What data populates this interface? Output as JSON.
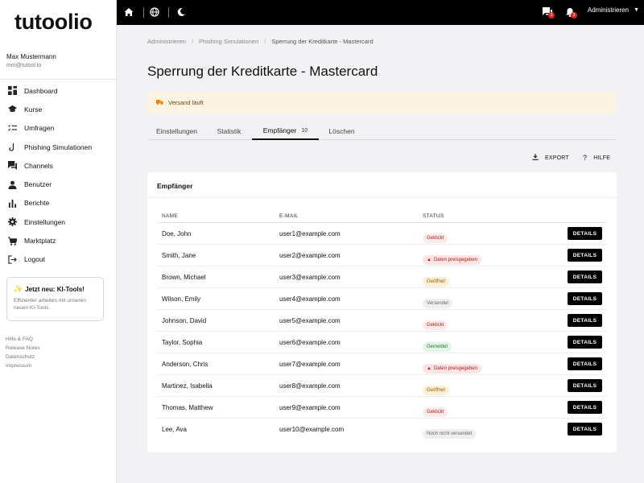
{
  "brand": {
    "logo": "tutoolio"
  },
  "user": {
    "name": "Max Mustermann",
    "email": "mm@tutool.io"
  },
  "sidebar": {
    "items": [
      {
        "label": "Dashboard",
        "icon": "dashboard-icon"
      },
      {
        "label": "Kurse",
        "icon": "graduation-cap-icon"
      },
      {
        "label": "Umfragen",
        "icon": "checklist-icon"
      },
      {
        "label": "Phishing Simulationen",
        "icon": "hook-icon"
      },
      {
        "label": "Channels",
        "icon": "chat-icon"
      },
      {
        "label": "Benutzer",
        "icon": "person-icon"
      },
      {
        "label": "Berichte",
        "icon": "bar-chart-icon"
      },
      {
        "label": "Einstellungen",
        "icon": "gear-icon"
      },
      {
        "label": "Marktplatz",
        "icon": "cart-icon"
      },
      {
        "label": "Logout",
        "icon": "logout-icon"
      }
    ],
    "promo": {
      "title": "Jetzt neu: KI-Tools!",
      "text": "Effizienter arbeiten mit unseren neuen KI-Tools."
    },
    "footer_links": [
      "Hilfe & FAQ",
      "Release Notes",
      "Datenschutz",
      "Impressum"
    ]
  },
  "topbar": {
    "notifications": {
      "chat_count": "3",
      "bell_count": "3"
    },
    "user_menu": "Administrieren"
  },
  "breadcrumb": [
    "Administrieren",
    "Phishing Simulationen",
    "Sperrung der Kreditkarte - Mastercard"
  ],
  "page": {
    "title": "Sperrung der Kreditkarte - Mastercard"
  },
  "status_banner": {
    "text": "Versand läuft"
  },
  "tabs": [
    {
      "label": "Einstellungen"
    },
    {
      "label": "Statistik"
    },
    {
      "label": "Empfänger",
      "count": "10",
      "active": true
    },
    {
      "label": "Löschen"
    }
  ],
  "actions": {
    "export": "EXPORT",
    "help": "HILFE"
  },
  "table": {
    "title": "Empfänger",
    "headers": {
      "name": "NAME",
      "email": "E-MAIL",
      "status": "STATUS"
    },
    "details_label": "DETAILS",
    "rows": [
      {
        "name": "Doe, John",
        "email": "user1@example.com",
        "status": "Geklickt",
        "kind": "geklickt"
      },
      {
        "name": "Smith, Jane",
        "email": "user2@example.com",
        "status": "Daten preisgegeben",
        "kind": "preis"
      },
      {
        "name": "Brown, Michael",
        "email": "user3@example.com",
        "status": "Geöffnet",
        "kind": "geoeffnet"
      },
      {
        "name": "Wilson, Emily",
        "email": "user4@example.com",
        "status": "Versendet",
        "kind": "versendet"
      },
      {
        "name": "Johnson, David",
        "email": "user5@example.com",
        "status": "Geklickt",
        "kind": "geklickt"
      },
      {
        "name": "Taylor, Sophia",
        "email": "user6@example.com",
        "status": "Gemeldet",
        "kind": "gemeldet"
      },
      {
        "name": "Anderson, Chris",
        "email": "user7@example.com",
        "status": "Daten preisgegeben",
        "kind": "preis"
      },
      {
        "name": "Martinez, Isabella",
        "email": "user8@example.com",
        "status": "Geöffnet",
        "kind": "geoeffnet"
      },
      {
        "name": "Thomas, Matthew",
        "email": "user9@example.com",
        "status": "Geklickt",
        "kind": "geklickt"
      },
      {
        "name": "Lee, Ava",
        "email": "user10@example.com",
        "status": "Noch nicht versendet",
        "kind": "versendet"
      }
    ]
  }
}
